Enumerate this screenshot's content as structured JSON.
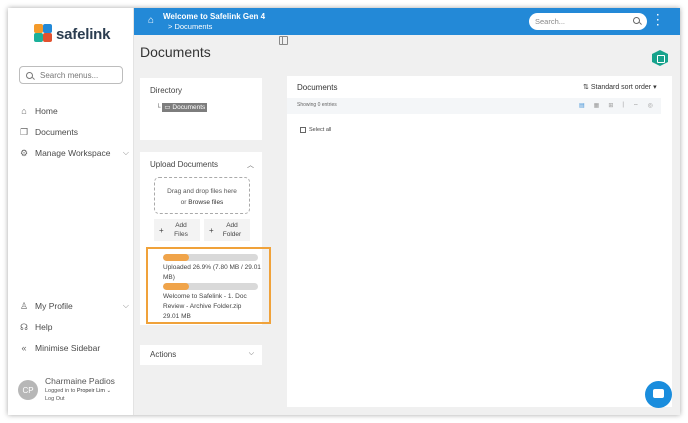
{
  "brand": {
    "name": "safelink"
  },
  "sidebar": {
    "search_placeholder": "Search menus...",
    "items": [
      {
        "label": "Home",
        "icon": "home-icon"
      },
      {
        "label": "Documents",
        "icon": "documents-icon"
      },
      {
        "label": "Manage Workspace",
        "icon": "gear-icon"
      }
    ],
    "bottom_items": [
      {
        "label": "My Profile",
        "icon": "user-icon"
      },
      {
        "label": "Help",
        "icon": "headset-icon"
      },
      {
        "label": "Minimise Sidebar",
        "icon": "double-chevron-left-icon"
      }
    ],
    "user": {
      "initials": "CP",
      "name": "Charmaine Padios",
      "logged_in_prefix": "Logged in to",
      "org": "Propeir Lim",
      "logout": "Log Out"
    }
  },
  "header": {
    "title": "Welcome to Safelink Gen 4",
    "breadcrumb": "> Documents",
    "search_placeholder": "Search..."
  },
  "left_panel": {
    "title": "Documents",
    "directory": {
      "heading": "Directory",
      "node": "Documents"
    },
    "upload": {
      "heading": "Upload Documents",
      "drop_text": "Drag and drop files here",
      "drop_or": "or",
      "browse": "Browse files",
      "add_files": "Add Files",
      "add_folder": "Add Folder",
      "progress_text": "Uploaded 26.9% (7.80 MB / 29.01 MB)",
      "progress_fraction": 0.269,
      "file_name": "Welcome to Safelink - 1. Doc Review - Archive Folder.zip",
      "file_size": "29.01 MB",
      "file_progress_fraction": 0.269
    },
    "actions": {
      "heading": "Actions"
    }
  },
  "main": {
    "heading": "Documents",
    "sort_label": "Standard sort order",
    "showing": "Showing 0 entries",
    "select_all": "Select all"
  },
  "colors": {
    "header_blue": "#2389d7",
    "highlight_orange": "#f0a23a",
    "progress_fill": "#f0a44a",
    "teal_badge": "#16a28c"
  }
}
